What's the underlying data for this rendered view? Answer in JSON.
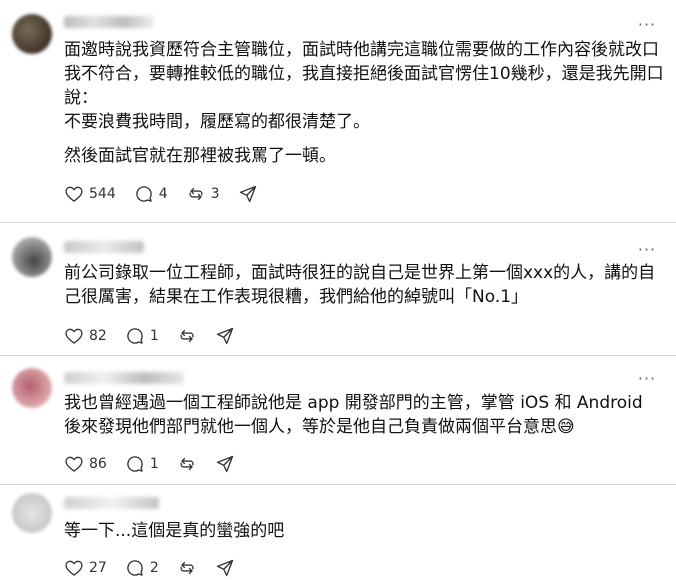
{
  "posts": [
    {
      "paragraphs": [
        "面邀時說我資歷符合主管職位，面試時他講完這職位需要做的工作內容後就改口我不符合，要轉推較低的職位，我直接拒絕後面試官愣住10幾秒，還是我先開口說：\n不要浪費我時間，履歷寫的都很清楚了。",
        "然後面試官就在那裡被我罵了一頓。"
      ],
      "likes": "544",
      "replies": "4",
      "reposts": "3"
    },
    {
      "paragraphs": [
        "前公司錄取一位工程師，面試時很狂的說自己是世界上第一個xxx的人，講的自己很厲害，結果在工作表現很糟，我們給他的綽號叫「No.1」"
      ],
      "likes": "82",
      "replies": "1",
      "reposts": ""
    },
    {
      "paragraphs": [
        "我也曾經遇過一個工程師說他是 app 開發部門的主管，掌管 iOS 和 Android\n後來發現他們部門就他一個人，等於是他自己負責做兩個平台意思😅"
      ],
      "likes": "86",
      "replies": "1",
      "reposts": ""
    },
    {
      "paragraphs": [
        "等一下...這個是真的蠻強的吧"
      ],
      "likes": "27",
      "replies": "2",
      "reposts": ""
    }
  ],
  "icons": {
    "like": "heart-icon",
    "reply": "comment-icon",
    "repost": "repost-icon",
    "share": "share-icon",
    "more": "more-icon"
  },
  "colors": {
    "text": "#111111",
    "icon": "#333333",
    "divider": "#d9d9d9"
  }
}
